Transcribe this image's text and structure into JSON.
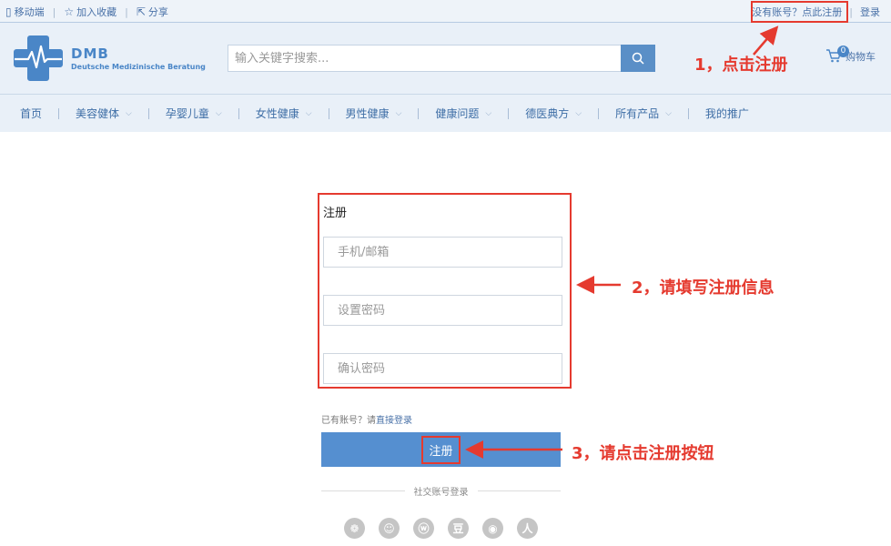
{
  "topbar": {
    "mobile": "移动端",
    "favorite": "加入收藏",
    "share": "分享",
    "no_account": "没有账号？点此注册",
    "login": "登录"
  },
  "header": {
    "logo_main": "DMB",
    "logo_sub": "Deutsche Medizinische Beratung",
    "search_placeholder": "输入关键字搜索...",
    "cart_count": "0",
    "cart_label": "购物车"
  },
  "nav": {
    "items": [
      {
        "label": "首页"
      },
      {
        "label": "美容健体"
      },
      {
        "label": "孕婴儿童"
      },
      {
        "label": "女性健康"
      },
      {
        "label": "男性健康"
      },
      {
        "label": "健康问题"
      },
      {
        "label": "德医典方"
      },
      {
        "label": "所有产品"
      },
      {
        "label": "我的推广"
      }
    ]
  },
  "form": {
    "title": "注册",
    "phone_placeholder": "手机/邮箱",
    "password_placeholder": "设置密码",
    "confirm_placeholder": "确认密码",
    "have_account": "已有账号？请",
    "direct_login": "直接登录",
    "submit_label": "注册",
    "social_label": "社交账号登录"
  },
  "social": {
    "icons": [
      "wechat-icon",
      "qq-icon",
      "weibo-icon",
      "douban-icon",
      "taobao-icon",
      "renren-icon"
    ],
    "glyphs": [
      "❁",
      "☺",
      "ⓦ",
      "豆",
      "◉",
      "人"
    ]
  },
  "annotations": {
    "step1": "1，点击注册",
    "step2": "2，请填写注册信息",
    "step3": "3，请点击注册按钮"
  },
  "colors": {
    "accent": "#4a86c7",
    "button": "#558fd0",
    "annotation": "#e53a2f"
  }
}
